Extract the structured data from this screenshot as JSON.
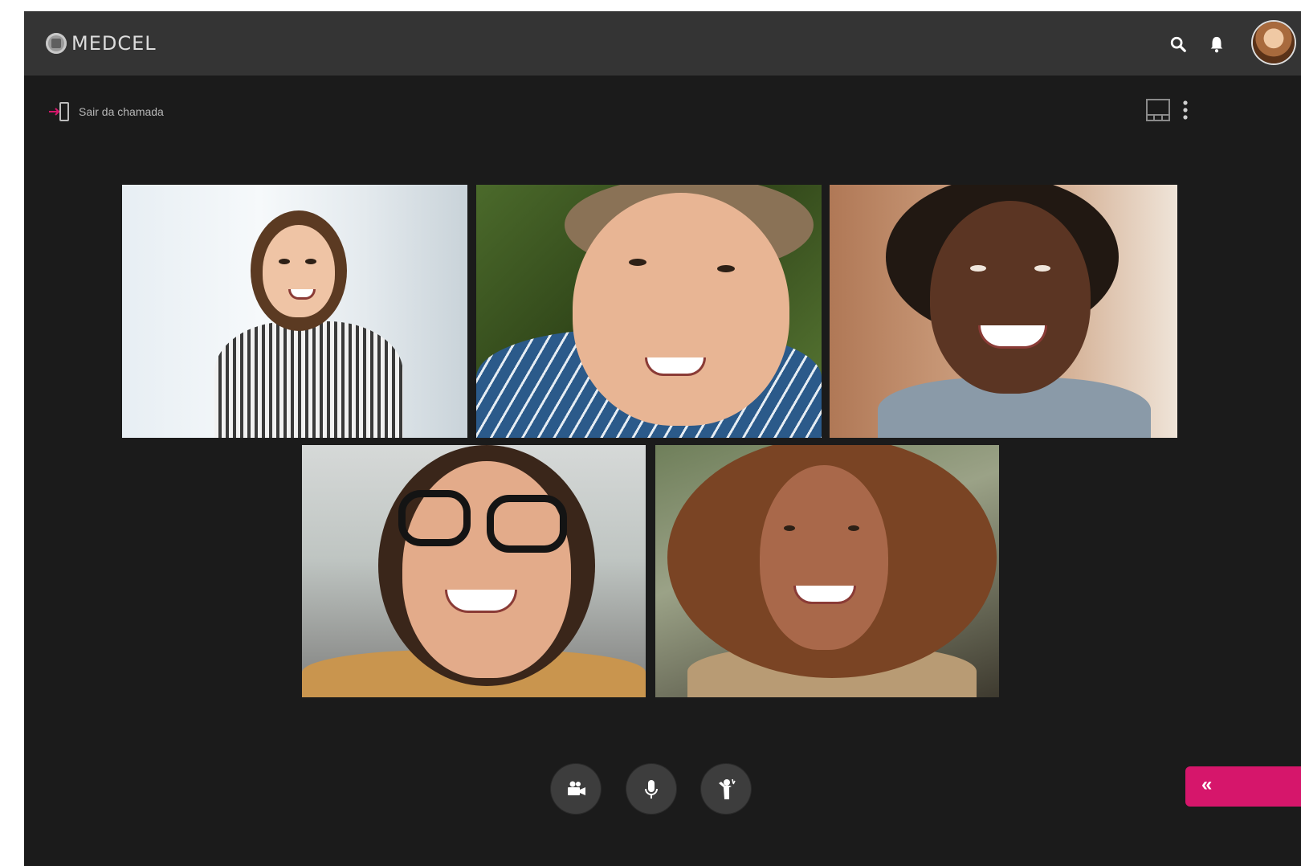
{
  "app": {
    "brand": "MEDCEL",
    "accent_color": "#d6166b"
  },
  "topbar": {
    "icons": [
      "search-icon",
      "bell-icon"
    ],
    "avatar": "user-avatar"
  },
  "call": {
    "leave_label": "Sair da chamada",
    "leave_icon": "exit-icon",
    "layout_icon": "layout-icon",
    "more_icon": "more-vertical-icon"
  },
  "participants": [
    {
      "tile": 1,
      "description_color": "#e7eef3"
    },
    {
      "tile": 2,
      "description_color": "#4b6a2b"
    },
    {
      "tile": 3,
      "description_color": "#c59473"
    },
    {
      "tile": 4,
      "description_color": "#bfc5c2"
    },
    {
      "tile": 5,
      "description_color": "#9ba287"
    }
  ],
  "controls": {
    "camera_icon": "camera-icon",
    "mic_icon": "microphone-icon",
    "hand_icon": "raise-hand-icon",
    "collapse_label": "«"
  }
}
